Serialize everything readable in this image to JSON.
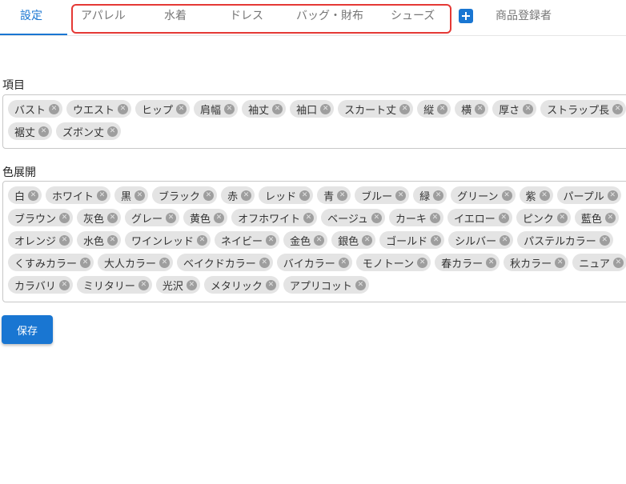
{
  "tabs": {
    "settings": "設定",
    "apparel": "アパレル",
    "swimwear": "水着",
    "dress": "ドレス",
    "bag_wallet": "バッグ・財布",
    "shoes": "シューズ",
    "registrants": "商品登録者"
  },
  "items": {
    "label": "項目",
    "chips": [
      [
        "バスト",
        "ウエスト",
        "ヒップ",
        "肩幅",
        "袖丈",
        "袖口",
        "スカート丈",
        "縦",
        "横",
        "厚さ",
        "ストラップ長"
      ],
      [
        "裾丈",
        "ズボン丈"
      ]
    ]
  },
  "colors": {
    "label": "色展開",
    "chips": [
      [
        "白",
        "ホワイト",
        "黒",
        "ブラック",
        "赤",
        "レッド",
        "青",
        "ブルー",
        "緑",
        "グリーン",
        "紫",
        "パープル"
      ],
      [
        "ブラウン",
        "灰色",
        "グレー",
        "黄色",
        "オフホワイト",
        "ベージュ",
        "カーキ",
        "イエロー",
        "ピンク",
        "藍色"
      ],
      [
        "オレンジ",
        "水色",
        "ワインレッド",
        "ネイビー",
        "金色",
        "銀色",
        "ゴールド",
        "シルバー",
        "パステルカラー"
      ],
      [
        "くすみカラー",
        "大人カラー",
        "ベイクドカラー",
        "バイカラー",
        "モノトーン",
        "春カラー",
        "秋カラー",
        "ニュア"
      ],
      [
        "カラバリ",
        "ミリタリー",
        "光沢",
        "メタリック",
        "アプリコット"
      ]
    ]
  },
  "save_label": "保存"
}
